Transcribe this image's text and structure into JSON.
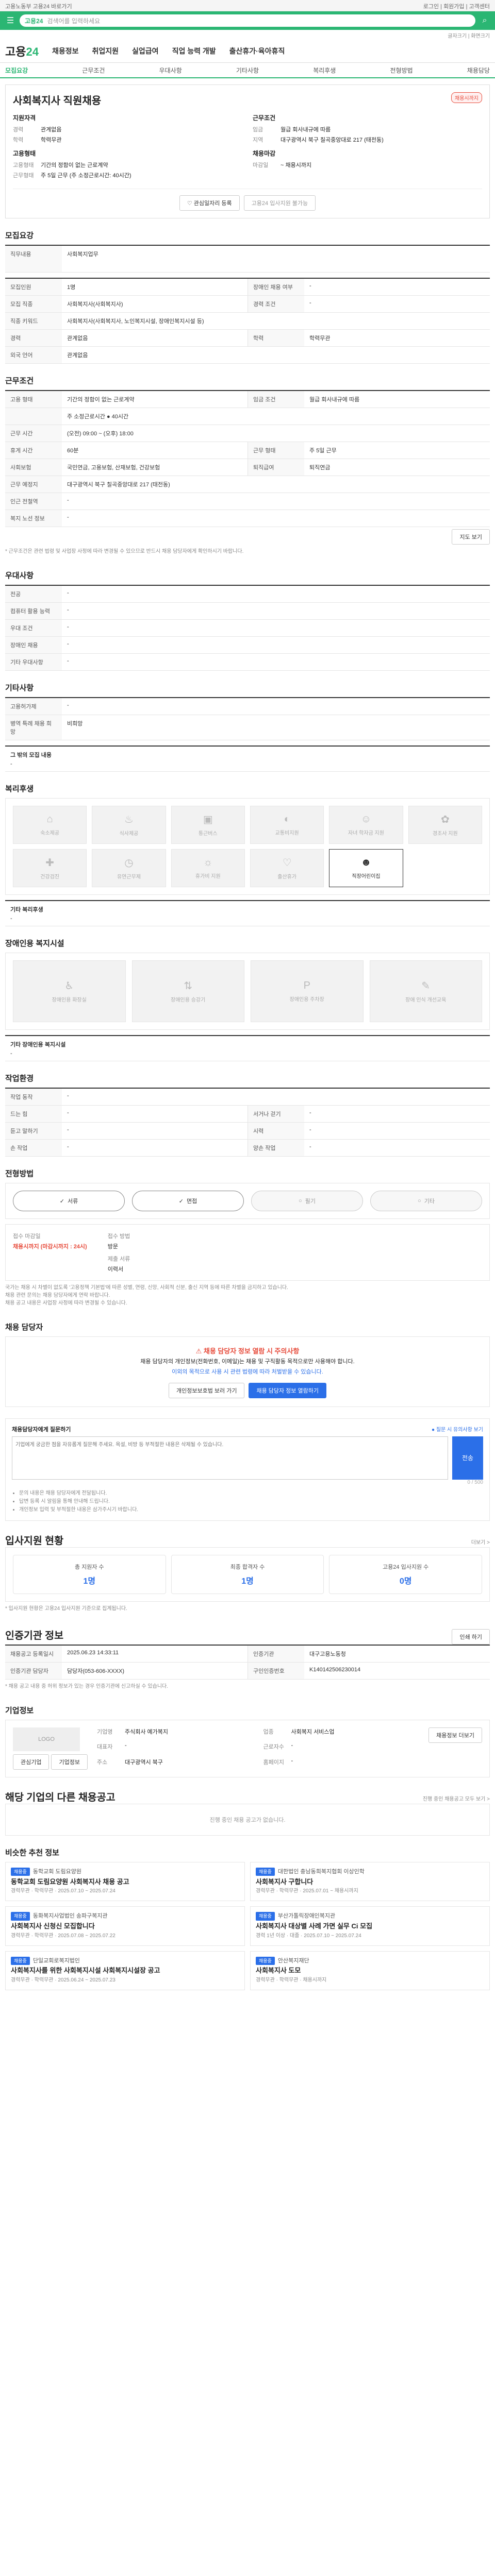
{
  "topbar": {
    "left": "고용노동부 고용24 바로가기",
    "right": "로그인 | 회원가입 | 고객센터"
  },
  "search": {
    "keyword": "고용24",
    "placeholder": "검색어를 입력하세요"
  },
  "util": "글자크기 | 화면크기",
  "gnb": {
    "logo_a": "고용",
    "logo_b": "24",
    "items": [
      "채용정보",
      "취업지원",
      "실업급여",
      "직업 능력 개발",
      "출산휴가·육아휴직"
    ]
  },
  "subnav": [
    "모집요강",
    "근무조건",
    "우대사항",
    "기타사항",
    "복리후생",
    "전형방법",
    "채용담당"
  ],
  "job": {
    "title": "사회복지사 직원채용",
    "badge": "채용시까지",
    "left_head": "지원자격",
    "left_rows": [
      {
        "k": "경력",
        "v": "관계없음"
      },
      {
        "k": "학력",
        "v": "학력무관"
      }
    ],
    "right_head": "근무조건",
    "right_rows": [
      {
        "k": "임금",
        "v": "월급 회사내규에 따름"
      },
      {
        "k": "지역",
        "v": "대구광역시 북구 칠곡중앙대로 217 (태전동)"
      }
    ],
    "left_head2": "고용형태",
    "left_rows2": [
      {
        "k": "고용형태",
        "v": "기간의 정함이 없는 근로계약"
      },
      {
        "k": "근무형태",
        "v": "주 5일 근무 (주 소정근로시간: 40시간)"
      }
    ],
    "right_head2": "채용마감",
    "right_rows2": [
      {
        "k": "마감일",
        "v": "~ 채용시까지"
      }
    ],
    "btn_scrap": "관심일자리 등록",
    "btn_apply": "고용24 입사지원 불가능"
  },
  "recruit": {
    "title": "모집요강",
    "task_label": "직무내용",
    "task_value": "사회복지업무",
    "rows": [
      {
        "a": "모집인원",
        "b": "1명",
        "c": "장애인 채용 여부",
        "d": "-"
      },
      {
        "a": "모집 직종",
        "b": "사회복지사(사회복지사)",
        "c": "경력 조건",
        "d": "-"
      },
      {
        "a": "직종 키워드",
        "b": "사회복지사(사회복지사, 노인복지시설, 장애인복지시설 등)",
        "c": "",
        "d": ""
      },
      {
        "a": "경력",
        "b": "관계없음",
        "c": "학력",
        "d": "학력무관"
      },
      {
        "a": "외국 언어",
        "b": "관계없음",
        "c": "",
        "d": ""
      }
    ]
  },
  "conditions": {
    "title": "근무조건",
    "rows": [
      {
        "a": "고용 형태",
        "b": "기간의 정함이 없는 근로계약",
        "c": "임금 조건",
        "d": "월급 회사내규에 따름"
      },
      {
        "a": "",
        "b": "주 소정근로시간 ● 40시간",
        "c": "",
        "d": ""
      },
      {
        "a": "근무 시간",
        "b": "(오전) 09:00 ~ (오후) 18:00",
        "c": "",
        "d": ""
      },
      {
        "a": "휴게 시간",
        "b": "60분",
        "c": "근무 형태",
        "d": "주 5일 근무"
      },
      {
        "a": "사회보험",
        "b": "국민연금, 고용보험, 산재보험, 건강보험",
        "c": "퇴직급여",
        "d": "퇴직연금"
      },
      {
        "a": "근무 예정지",
        "b": "대구광역시 북구 칠곡중앙대로 217 (태전동)",
        "c": "",
        "d": ""
      },
      {
        "a": "인근 전철역",
        "b": "-",
        "c": "",
        "d": ""
      },
      {
        "a": "복지 노선 정보",
        "b": "-",
        "c": "",
        "d": ""
      }
    ],
    "map_btn": "지도 보기",
    "note": "* 근무조건은 관련 법령 및 사업장 사정에 따라 변경될 수 있으므로 반드시 채용 담당자에게 확인하시기 바랍니다."
  },
  "prefer": {
    "title": "우대사항",
    "rows": [
      {
        "a": "전공",
        "b": "-"
      },
      {
        "a": "컴퓨터 활용 능력",
        "b": "-"
      },
      {
        "a": "우대 조건",
        "b": "-"
      },
      {
        "a": "장애인 채용",
        "b": "-"
      },
      {
        "a": "기타 우대사항",
        "b": "-"
      }
    ]
  },
  "etc": {
    "title": "기타사항",
    "rows": [
      {
        "a": "고용허가제",
        "b": "-"
      },
      {
        "a": "병역 특례 채용 희망",
        "b": "비희망"
      }
    ],
    "subtitle": "그 밖의 모집 내용",
    "subvalue": "-"
  },
  "welfare": {
    "title": "복리후생",
    "tiles": [
      {
        "icon": "house-icon",
        "label": "숙소제공",
        "on": false
      },
      {
        "icon": "meal-icon",
        "label": "식사제공",
        "on": false
      },
      {
        "icon": "bus-icon",
        "label": "통근버스",
        "on": false
      },
      {
        "icon": "car-icon",
        "label": "교통비지원",
        "on": false
      },
      {
        "icon": "child-icon",
        "label": "자녀 학자금 지원",
        "on": false
      },
      {
        "icon": "gift-icon",
        "label": "경조사 지원",
        "on": false
      },
      {
        "icon": "health-icon",
        "label": "건강검진",
        "on": false
      },
      {
        "icon": "clock-icon",
        "label": "유연근무제",
        "on": false
      },
      {
        "icon": "vacation-icon",
        "label": "휴가비 지원",
        "on": false
      },
      {
        "icon": "baby-icon",
        "label": "출산휴가",
        "on": false
      },
      {
        "icon": "care-icon",
        "label": "직장어린이집",
        "on": true
      }
    ],
    "other_label": "기타 복리후생",
    "other_value": "-"
  },
  "disabled": {
    "title": "장애인용 복지시설",
    "tiles": [
      "장애인용 화장실",
      "장애인용 승강기",
      "장애인용 주차장",
      "장애 인식 개선교육"
    ],
    "other_label": "기타 장애인용 복지시설",
    "other_value": "-"
  },
  "env": {
    "title": "작업환경",
    "rows": [
      {
        "a": "작업 동작",
        "b": "-",
        "c": "",
        "d": ""
      },
      {
        "a": "드는 힘",
        "b": "-",
        "c": "서거나 걷기",
        "d": "-"
      },
      {
        "a": "듣고 말하기",
        "b": "-",
        "c": "시력",
        "d": "-"
      },
      {
        "a": "손 작업",
        "b": "-",
        "c": "양손 작업",
        "d": "-"
      }
    ]
  },
  "selection": {
    "title": "전형방법",
    "steps": [
      {
        "label": "서류",
        "on": true
      },
      {
        "label": "면접",
        "on": true
      },
      {
        "label": "필기",
        "on": false
      },
      {
        "label": "기타",
        "on": false
      }
    ],
    "apply_label": "접수 마감일",
    "apply_value": "채용시까지 (마감시까지 : 24시)",
    "method_label": "접수 방법",
    "method_value": "방문",
    "doc_label": "제출 서류",
    "doc_value": "이력서",
    "notes": [
      "국가는 채용 시 차별이 없도록 '고용정책 기본법'에 따른 성별, 연령, 신앙, 사회적 신분, 출신 지역 등에 따른 차별을 금지하고 있습니다.",
      "채용 관련 문의는 채용 담당자에게 연락 바랍니다.",
      "채용 공고 내용은 사업장 사정에 따라 변경될 수 있습니다."
    ]
  },
  "contact": {
    "title": "채용 담당자",
    "alert_title": "채용 담당자 정보 열람 시 주의사항",
    "alert_lines": [
      "채용 담당자의 개인정보(전화번호, 이메일)는 채용 및 구직활동 목적으로만 사용해야 합니다.",
      "이외의 목적으로 사용 시 관련 법령에 따라 처벌받을 수 있습니다."
    ],
    "btn_a": "개인정보보호법 보러 가기",
    "btn_b": "채용 담당자 정보 열람하기"
  },
  "qa": {
    "title": "채용담당자에게 질문하기",
    "hint": "● 질문 시 유의사항 보기",
    "placeholder": "기업에게 궁금한 점을 자유롭게 질문해 주세요. 욕설, 비방 등 부적절한 내용은 삭제될 수 있습니다.",
    "send": "전송",
    "count": "0 / 500",
    "notes": [
      "문의 내용은 채용 담당자에게 전달됩니다.",
      "답변 등록 시 알림을 통해 안내해 드립니다.",
      "개인정보 입력 및 부적절한 내용은 삼가주시기 바랍니다."
    ]
  },
  "stats": {
    "title": "입사지원 현황",
    "more": "더보기 >",
    "items": [
      {
        "label": "총 지원자 수",
        "num": "1명"
      },
      {
        "label": "최종 합격자 수",
        "num": "1명"
      },
      {
        "label": "고용24 입사지원 수",
        "num": "0명"
      }
    ],
    "note": "* 입사지원 현황은 고용24 입사지원 기준으로 집계됩니다."
  },
  "info": {
    "title": "인증기관 정보",
    "print": "인쇄 하기",
    "rows": [
      {
        "a": "채용공고 등록일시",
        "b": "2025.06.23 14:33:11",
        "c": "인증기관",
        "d": "대구고용노동청"
      },
      {
        "a": "인증기관 담당자",
        "b": "담당자(053-606-XXXX)",
        "c": "구인인증번호",
        "d": "K140142506230014"
      }
    ],
    "note": "* 채용 공고 내용 중 허위 정보가 있는 경우 인증기관에 신고하실 수 있습니다."
  },
  "company": {
    "title": "기업정보",
    "logo": "LOGO",
    "btn_a": "관심기업",
    "btn_b": "기업정보",
    "btn_more": "채용정보 더보기",
    "rows": [
      {
        "k": "기업명",
        "v": "주식회사 예가복지"
      },
      {
        "k": "업종",
        "v": "사회복지 서비스업"
      },
      {
        "k": "대표자",
        "v": "-"
      },
      {
        "k": "근로자수",
        "v": "-"
      },
      {
        "k": "주소",
        "v": "대구광역시 북구"
      },
      {
        "k": "홈페이지",
        "v": "-"
      }
    ]
  },
  "same": {
    "title": "해당 기업의 다른 채용공고",
    "more": "진행 중인 채용공고 모두 보기 >",
    "empty": "진행 중인 채용 공고가 없습니다."
  },
  "recommend": {
    "title": "비슷한 추천 정보",
    "cards": [
      {
        "tag": "채용중",
        "org": "동학교회 도림요양원",
        "title": "동학교회 도림요양원 사회복지사 채용 공고",
        "meta": "경력무관 · 학력무관 · 2025.07.10 ~ 2025.07.24"
      },
      {
        "tag": "채용중",
        "org": "대한법인 충남동희복지협회 이상인학",
        "title": "사회복지사 구합니다",
        "meta": "경력무관 · 학력무관 · 2025.07.01 ~ 채용시까지"
      },
      {
        "tag": "채용중",
        "org": "동화복지사업법인 송파구복지관",
        "title": "사회복지사 신청신 모집합니다",
        "meta": "경력무관 · 학력무관 · 2025.07.08 ~ 2025.07.22"
      },
      {
        "tag": "채용중",
        "org": "부산가톨릭장애인복지관",
        "title": "사회복지사 대상별 사례 가면 실무 Ci 모집",
        "meta": "경력 1년 이상 · 대졸 · 2025.07.10 ~ 2025.07.24"
      },
      {
        "tag": "채용중",
        "org": "단일교회로복지법인",
        "title": "사회복지사를 위한 사회복지시설 사회복지시설장 공고",
        "meta": "경력무관 · 학력무관 · 2025.06.24 ~ 2025.07.23"
      },
      {
        "tag": "채용중",
        "org": "안산복지재단",
        "title": "사회복지사 도모",
        "meta": "경력무관 · 학력무관 · 채용시까지"
      }
    ]
  }
}
